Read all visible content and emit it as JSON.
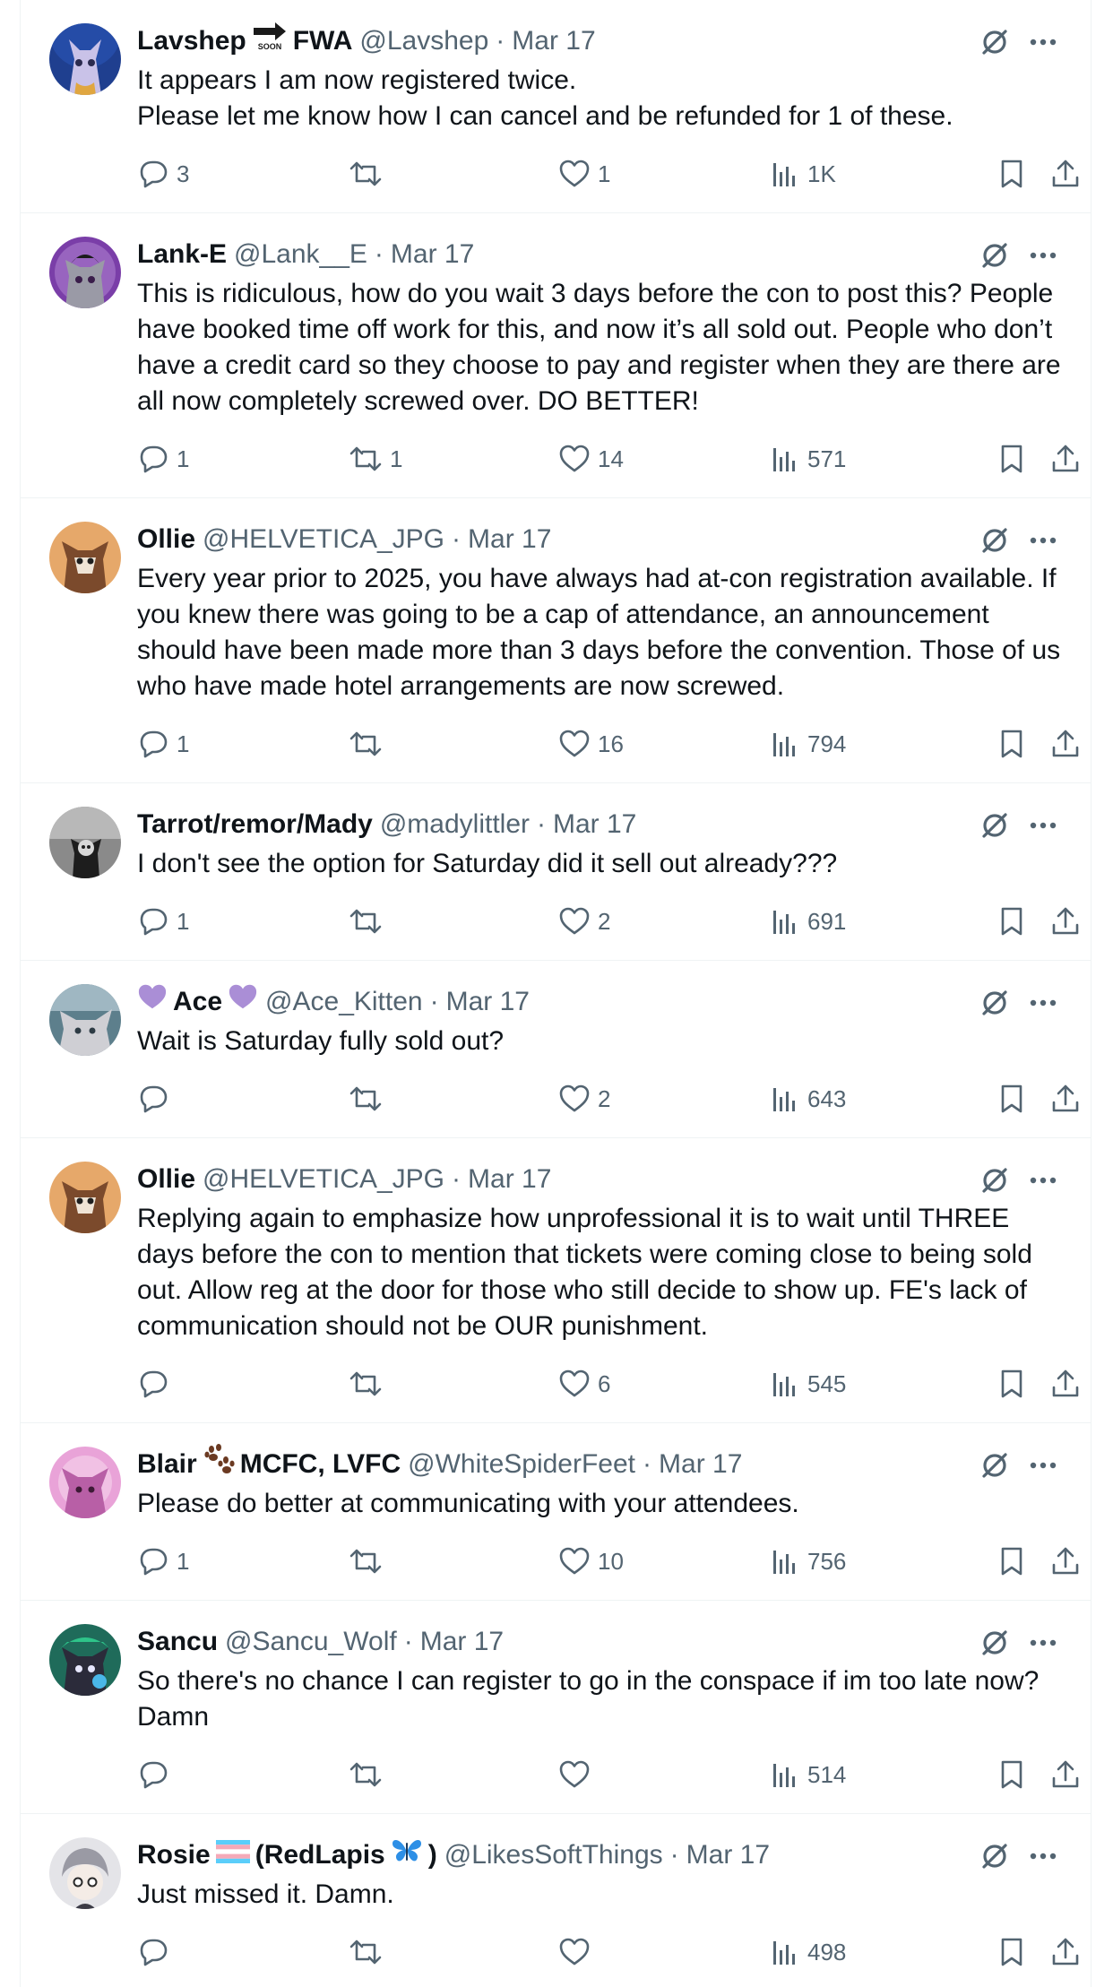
{
  "tweets": [
    {
      "display_name_parts": [
        "Lavshep",
        "FWA"
      ],
      "name_emoji": "soon-arrow-icon",
      "handle": "@Lavshep",
      "time": "Mar 17",
      "text": "It appears I am now registered twice.\nPlease let me know how I can cancel and be refunded for 1 of these.",
      "replies": "3",
      "retweets": "",
      "likes": "1",
      "views": "1K",
      "avatar_bg": "#1f3f8f"
    },
    {
      "display_name": "Lank-E",
      "handle": "@Lank__E",
      "time": "Mar 17",
      "text": "This is ridiculous, how do you wait 3 days before the con to post this? People have booked time off work for this, and now it’s all sold out. People who don’t have a credit card so they choose to pay and register when they are there are all now completely screwed over. DO BETTER!",
      "replies": "1",
      "retweets": "1",
      "likes": "14",
      "views": "571",
      "avatar_bg": "#7a3ea8"
    },
    {
      "display_name": "Ollie",
      "handle": "@HELVETICA_JPG",
      "time": "Mar 17",
      "text": "Every year prior to 2025, you have always had at-con registration available. If you knew there was going to be a cap of attendance, an announcement should have been made more than 3 days before the convention. Those of us who have made hotel arrangements are now screwed.",
      "replies": "1",
      "retweets": "",
      "likes": "16",
      "views": "794",
      "avatar_bg": "#e6a86a"
    },
    {
      "display_name": "Tarrot/remor/Mady",
      "handle": "@madylittler",
      "time": "Mar 17",
      "text": "I don't see the option for Saturday did it sell out already???",
      "replies": "1",
      "retweets": "",
      "likes": "2",
      "views": "691",
      "avatar_bg": "#6b6b6b"
    },
    {
      "display_name_parts": [
        "Ace"
      ],
      "name_emoji": "purple-heart-icon",
      "handle": "@Ace_Kitten",
      "time": "Mar 17",
      "text": "Wait is Saturday fully sold out?",
      "replies": "",
      "retweets": "",
      "likes": "2",
      "views": "643",
      "avatar_bg": "#5d7f8c"
    },
    {
      "display_name": "Ollie",
      "handle": "@HELVETICA_JPG",
      "time": "Mar 17",
      "text": "Replying again to emphasize how unprofessional it is to wait until THREE days before the con to mention that tickets were coming close to being sold out. Allow reg at the door for those who still decide to show up. FE's lack of communication should not be OUR punishment.",
      "replies": "",
      "retweets": "",
      "likes": "6",
      "views": "545",
      "avatar_bg": "#e6a86a"
    },
    {
      "display_name_parts": [
        "Blair",
        "MCFC, LVFC"
      ],
      "name_emoji": "paw-prints-icon",
      "handle": "@WhiteSpiderFeet",
      "time": "Mar 17",
      "text": "Please do better at communicating with your attendees.",
      "replies": "1",
      "retweets": "",
      "likes": "10",
      "views": "756",
      "avatar_bg": "#e9a3d8"
    },
    {
      "display_name": "Sancu",
      "handle": "@Sancu_Wolf",
      "time": "Mar 17",
      "text": "So there's no chance I can register to go in the conspace if im too late now? Damn",
      "replies": "",
      "retweets": "",
      "likes": "",
      "views": "514",
      "avatar_bg": "#1f6b5a"
    },
    {
      "display_name_parts": [
        "Rosie",
        "(RedLapis",
        ")"
      ],
      "name_emoji": "trans-flag-icon",
      "name_emoji_2": "butterfly-icon",
      "handle": "@LikesSoftThings",
      "time": "Mar 17",
      "text": "Just missed it. Damn.",
      "replies": "",
      "retweets": "",
      "likes": "",
      "views": "498",
      "avatar_bg": "#e4e4e8"
    }
  ],
  "colors": {
    "text": "#0f1419",
    "secondary": "#536471",
    "border": "#eff3f4"
  }
}
